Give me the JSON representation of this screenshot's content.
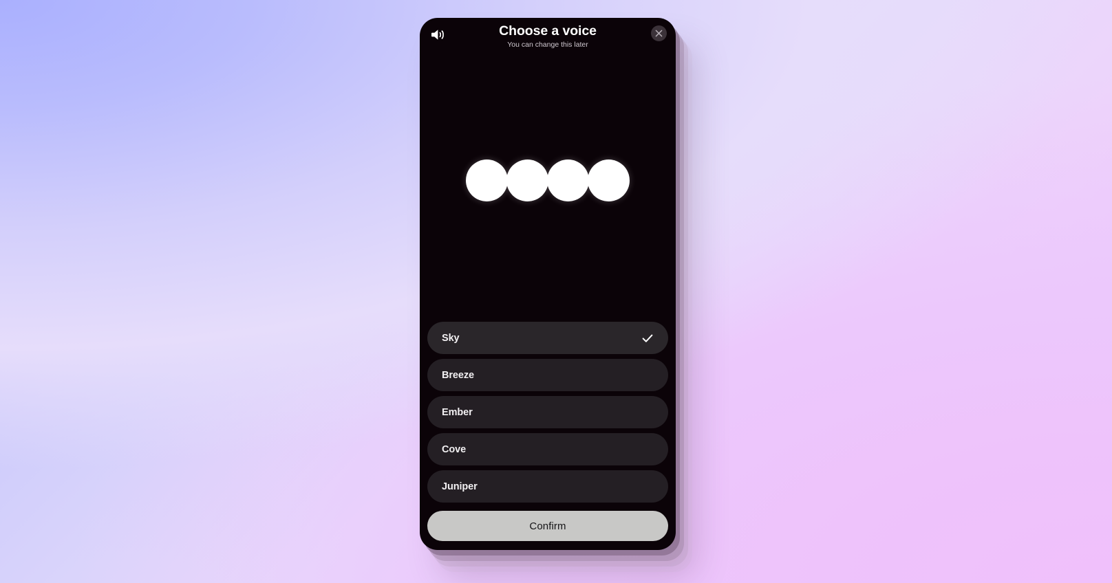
{
  "screen": {
    "background_colors": {
      "top_left": "#b0b4fd",
      "top_right": "#e8e1fc",
      "bottom_left": "#ddd8fb",
      "bottom_right": "#eec2fb"
    }
  },
  "phone": {
    "screen_bg": "#0b0308"
  },
  "header": {
    "speaker_icon": "speaker-wave-icon",
    "title": "Choose a voice",
    "subtitle": "You can change this later",
    "close_icon": "close-x-icon"
  },
  "stage": {
    "orb_icon": "voice-orb",
    "orb_count": 4,
    "orb_color": "#ffffff"
  },
  "voices": {
    "check_icon": "check-icon",
    "items": [
      {
        "label": "Sky",
        "selected": true
      },
      {
        "label": "Breeze",
        "selected": false
      },
      {
        "label": "Ember",
        "selected": false
      },
      {
        "label": "Cove",
        "selected": false
      },
      {
        "label": "Juniper",
        "selected": false
      }
    ]
  },
  "footer": {
    "confirm_label": "Confirm",
    "confirm_bg": "#c8c8c6",
    "confirm_text_color": "#151416"
  }
}
